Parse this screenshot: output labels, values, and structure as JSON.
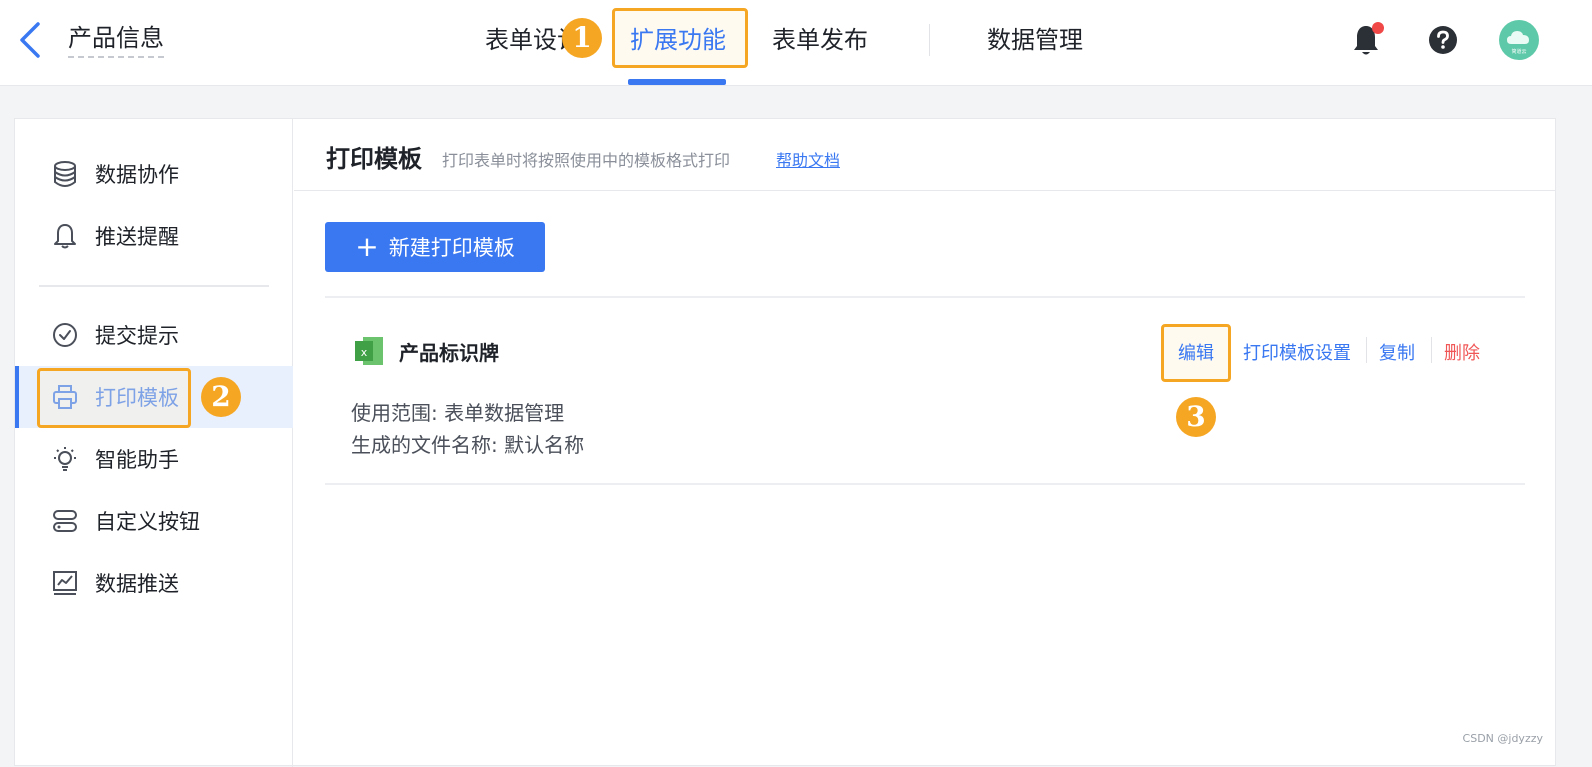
{
  "header": {
    "title": "产品信息",
    "tabs": [
      {
        "label": "表单设计"
      },
      {
        "label": "扩展功能"
      },
      {
        "label": "表单发布"
      },
      {
        "label": "数据管理"
      }
    ],
    "avatar_text": "简道云"
  },
  "steps": {
    "one": "1",
    "two": "2",
    "three": "3"
  },
  "sidebar": {
    "items": [
      {
        "label": "数据协作",
        "icon": "database-icon"
      },
      {
        "label": "推送提醒",
        "icon": "bell-icon"
      },
      {
        "label": "提交提示",
        "icon": "check-circle-icon"
      },
      {
        "label": "打印模板",
        "icon": "printer-icon"
      },
      {
        "label": "智能助手",
        "icon": "bulb-icon"
      },
      {
        "label": "自定义按钮",
        "icon": "toggle-button-icon"
      },
      {
        "label": "数据推送",
        "icon": "chart-icon"
      }
    ]
  },
  "main": {
    "title": "打印模板",
    "description": "打印表单时将按照使用中的模板格式打印",
    "help_link": "帮助文档",
    "new_button": "新建打印模板",
    "template": {
      "name": "产品标识牌",
      "scope": "使用范围: 表单数据管理",
      "file_name": "生成的文件名称: 默认名称",
      "actions": {
        "edit": "编辑",
        "settings": "打印模板设置",
        "copy": "复制",
        "delete": "删除"
      }
    }
  },
  "colors": {
    "accent": "#3a78f2",
    "highlight": "#f5a623",
    "danger": "#f05656"
  },
  "watermark": "CSDN @jdyzzy"
}
